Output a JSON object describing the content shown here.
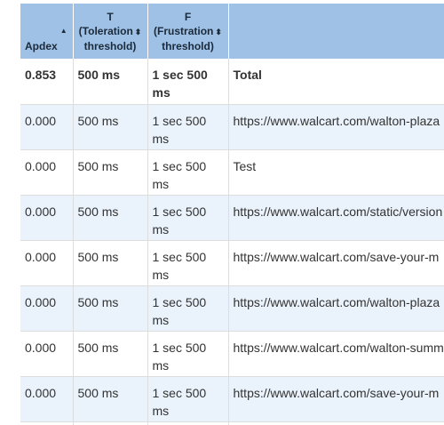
{
  "table": {
    "headers": {
      "apdex": {
        "label": "Apdex",
        "sort": "▲"
      },
      "t": {
        "letter": "T",
        "line1": "(Toleration",
        "line2": "threshold)",
        "sort": "⬍"
      },
      "f": {
        "letter": "F",
        "line1": "(Frustration",
        "line2": "threshold)",
        "sort": "⬍"
      },
      "label": ""
    },
    "rows": [
      {
        "apdex": "0.853",
        "t": "500 ms",
        "f": "1 sec 500 ms",
        "label": "Total"
      },
      {
        "apdex": "0.000",
        "t": "500 ms",
        "f": "1 sec 500 ms",
        "label": "https://www.walcart.com/walton-plaza"
      },
      {
        "apdex": "0.000",
        "t": "500 ms",
        "f": "1 sec 500 ms",
        "label": "Test"
      },
      {
        "apdex": "0.000",
        "t": "500 ms",
        "f": "1 sec 500 ms",
        "label": "https://www.walcart.com/static/version"
      },
      {
        "apdex": "0.000",
        "t": "500 ms",
        "f": "1 sec 500 ms",
        "label": "https://www.walcart.com/save-your-m"
      },
      {
        "apdex": "0.000",
        "t": "500 ms",
        "f": "1 sec 500 ms",
        "label": "https://www.walcart.com/walton-plaza"
      },
      {
        "apdex": "0.000",
        "t": "500 ms",
        "f": "1 sec 500 ms",
        "label": "https://www.walcart.com/walton-summ"
      },
      {
        "apdex": "0.000",
        "t": "500 ms",
        "f": "1 sec 500 ms",
        "label": "https://www.walcart.com/save-your-m"
      }
    ]
  },
  "colors": {
    "header_bg": "#9fc1e6",
    "row_alt_bg": "#eaf2fb",
    "border": "#dddddd"
  }
}
